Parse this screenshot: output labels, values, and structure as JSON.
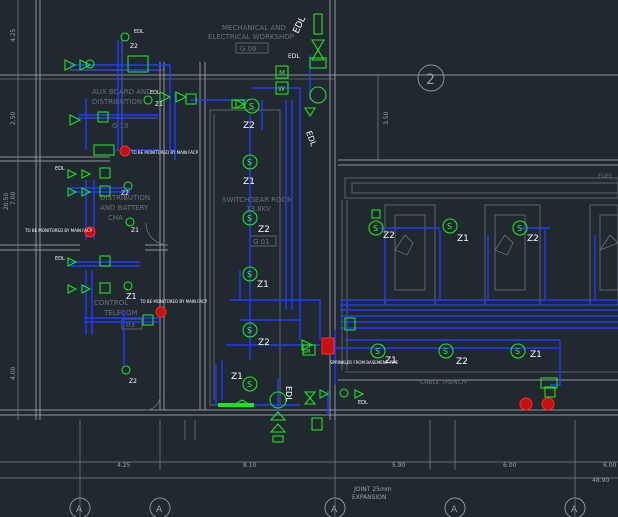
{
  "colors": {
    "background": "#212830",
    "wall": "#8d949c",
    "pipe": "#1f3cff",
    "equipment": "#1ee31e",
    "alarm": "#ff2a2a",
    "annotation": "#ffffff"
  },
  "rooms": {
    "mech_workshop": "MECHANICAL AND\nELECTRICAL WORKSHOP",
    "mech_workshop_line1": "MECHANICAL AND",
    "mech_workshop_line2": "ELECTRICAL WORKSHOP",
    "mech_workshop_tag": "G 06",
    "aux_board": "AUX BOARD AND",
    "aux_board_2": "DISTRIBUTION",
    "aux_board_tag": "G 10",
    "distribution": "DISTRIBUTION",
    "distribution_2": "AND BATTERY",
    "distribution_3": "CHA",
    "control": "CONTROL",
    "telecom": "TELECOM",
    "telecom_tag": "03",
    "switchgear": "SWITCHGEAR ROOM",
    "switchgear_2": "13.8KV",
    "switchgear_tag": "G 01",
    "cable_trench": "CABLE TRENCH",
    "fuel": "FUEL"
  },
  "grid": {
    "bubble_2": "2",
    "bottom_A": "A"
  },
  "dimensions": {
    "left_top": "4.25",
    "left_mid1": "2.50",
    "left_mid2": "20.50",
    "left_mid3": "7.00",
    "left_bot": "4.00",
    "right_3_50": "3.50",
    "bot_425": "4.25",
    "bot_810": "8.10",
    "bot_590": "5.90",
    "bot_600": "6.00",
    "bot_600b": "6.00",
    "bot_total": "48.90",
    "joint": "JOINT 25mm",
    "expansion": "EXPANSION"
  },
  "labels": {
    "edl": "EDL",
    "z1": "Z1",
    "z2": "Z2",
    "s": "S",
    "m": "M",
    "w": "W",
    "sm": "SM",
    "to_be_monitored": "TO BE MONITORED BY MAIN FACP",
    "to_be_monitored_2": "TO BE MONITORED BY MAIN FACP",
    "to_be_monitored_3": "TO BE MONITORED BY MAIN FACP",
    "to_be_monitored_4": "TO BE MONITORED BY MAIN FACP",
    "valve_tag": "SM",
    "note_bottom": "SPRINKLER FROM BASEMENT PIPE"
  }
}
